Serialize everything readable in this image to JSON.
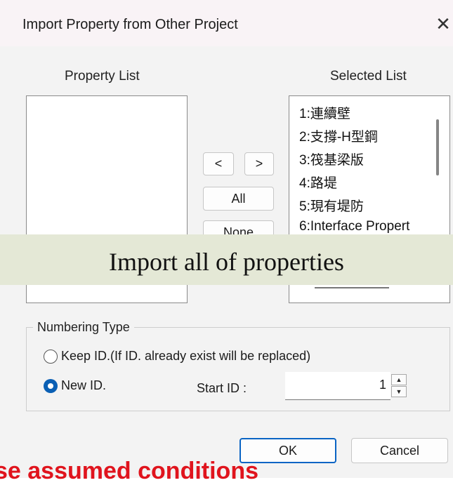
{
  "dialog": {
    "title": "Import Property from Other Project",
    "close_glyph": "✕"
  },
  "property_list": {
    "header": "Property List",
    "items": []
  },
  "selected_list": {
    "header": "Selected List",
    "items": [
      "1:連續壁",
      "2:支撐-H型鋼",
      "3:筏基梁版",
      "4:路堤",
      "5:現有堤防",
      "6:Interface Propert"
    ]
  },
  "transfer_buttons": {
    "move_left": "<",
    "move_right": ">",
    "all": "All",
    "none": "None"
  },
  "banner": {
    "text": "Import all of properties"
  },
  "numbering_type": {
    "label": "Numbering Type",
    "keep_id": "Keep ID.(If ID. already exist will be replaced)",
    "new_id": "New ID.",
    "selected": "new_id",
    "start_id_label": "Start ID :",
    "start_id_value": "1"
  },
  "actions": {
    "ok": "OK",
    "cancel": "Cancel"
  },
  "footer": {
    "partial_text": "se assumed conditions"
  },
  "colors": {
    "accent": "#0a64c4",
    "banner_bg": "#e4e8d6",
    "footer_text": "#e0141d"
  }
}
